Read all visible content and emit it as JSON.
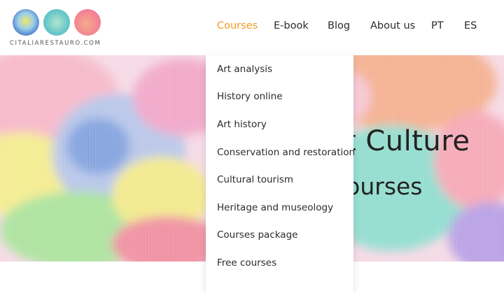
{
  "logo": {
    "text": "CITALIARESTAURO.COM",
    "colors": [
      "#5aa7d9",
      "#4fc1bd",
      "#f08a7a"
    ]
  },
  "nav": {
    "courses": "Courses",
    "ebook": "E-book",
    "blog": "Blog",
    "about": "About us",
    "pt": "PT",
    "es": "ES",
    "active_color": "#f39a21"
  },
  "dropdown": {
    "items": [
      "Art analysis",
      "History online",
      "Art history",
      "Conservation and restoration",
      "Cultural tourism",
      "Heritage and museology",
      "Courses package",
      "Free courses"
    ]
  },
  "hero": {
    "title": "rt  Culture",
    "subtitle": "courses"
  }
}
